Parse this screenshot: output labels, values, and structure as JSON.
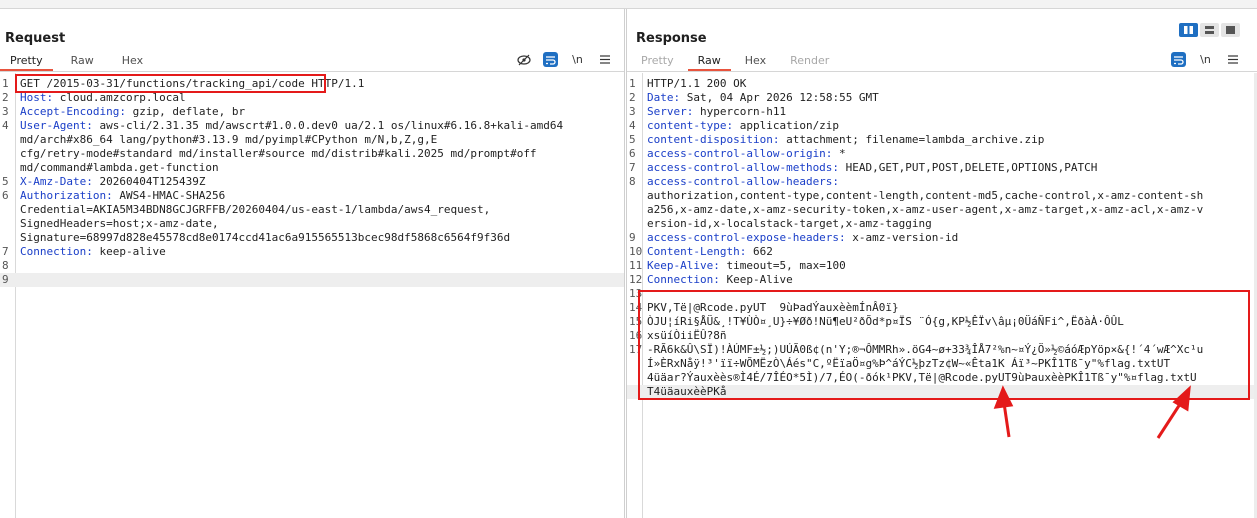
{
  "request": {
    "title": "Request",
    "tabs": [
      "Pretty",
      "Raw",
      "Hex"
    ],
    "active_tab": "Pretty",
    "tools": {
      "newline_label": "\\n"
    },
    "lines": [
      {
        "n": "1",
        "parts": [
          {
            "t": "GET /2015-03-31/functions/tracking_api/code",
            "c": "plain"
          },
          {
            "t": " HTTP/1.1",
            "c": "plain"
          }
        ]
      },
      {
        "n": "2",
        "parts": [
          {
            "t": "Host:",
            "c": "key"
          },
          {
            "t": " cloud.amzcorp.local",
            "c": "plain"
          }
        ]
      },
      {
        "n": "3",
        "parts": [
          {
            "t": "Accept-Encoding:",
            "c": "key"
          },
          {
            "t": " gzip, deflate, br",
            "c": "plain"
          }
        ]
      },
      {
        "n": "4",
        "parts": [
          {
            "t": "User-Agent:",
            "c": "key"
          },
          {
            "t": " aws-cli/2.31.35 md/awscrt#1.0.0.dev0 ua/2.1 os/linux#6.16.8+kali-amd64",
            "c": "plain"
          }
        ]
      },
      {
        "n": "",
        "parts": [
          {
            "t": "md/arch#x86_64 lang/python#3.13.9 md/pyimpl#CPython m/N,b,Z,g,E",
            "c": "plain"
          }
        ]
      },
      {
        "n": "",
        "parts": [
          {
            "t": "cfg/retry-mode#standard md/installer#source md/distrib#kali.2025 md/prompt#off",
            "c": "plain"
          }
        ]
      },
      {
        "n": "",
        "parts": [
          {
            "t": "md/command#lambda.get-function",
            "c": "plain"
          }
        ]
      },
      {
        "n": "5",
        "parts": [
          {
            "t": "X-Amz-Date:",
            "c": "key"
          },
          {
            "t": " 20260404T125439Z",
            "c": "plain"
          }
        ]
      },
      {
        "n": "6",
        "parts": [
          {
            "t": "Authorization:",
            "c": "key"
          },
          {
            "t": " AWS4-HMAC-SHA256",
            "c": "plain"
          }
        ]
      },
      {
        "n": "",
        "parts": [
          {
            "t": "Credential=AKIA5M34BDN8GCJGRFFB/20260404/us-east-1/lambda/aws4_request,",
            "c": "plain"
          }
        ]
      },
      {
        "n": "",
        "parts": [
          {
            "t": "SignedHeaders=host;x-amz-date,",
            "c": "plain"
          }
        ]
      },
      {
        "n": "",
        "parts": [
          {
            "t": "Signature=68997d828e45578cd8e0174ccd41ac6a915565513bcec98df5868c6564f9f36d",
            "c": "plain"
          }
        ]
      },
      {
        "n": "7",
        "parts": [
          {
            "t": "Connection:",
            "c": "key"
          },
          {
            "t": " keep-alive",
            "c": "plain"
          }
        ]
      },
      {
        "n": "8",
        "parts": [
          {
            "t": "",
            "c": "plain"
          }
        ]
      },
      {
        "n": "9",
        "parts": [
          {
            "t": "",
            "c": "plain"
          }
        ]
      }
    ]
  },
  "response": {
    "title": "Response",
    "tabs": [
      "Pretty",
      "Raw",
      "Hex",
      "Render"
    ],
    "active_tab": "Raw",
    "tools": {
      "newline_label": "\\n"
    },
    "lines": [
      {
        "n": "1",
        "parts": [
          {
            "t": "HTTP/1.1 200 OK",
            "c": "plain"
          }
        ]
      },
      {
        "n": "2",
        "parts": [
          {
            "t": "Date:",
            "c": "key"
          },
          {
            "t": " Sat, 04 Apr 2026 12:58:55 GMT",
            "c": "plain"
          }
        ]
      },
      {
        "n": "3",
        "parts": [
          {
            "t": "Server:",
            "c": "key"
          },
          {
            "t": " hypercorn-h11",
            "c": "plain"
          }
        ]
      },
      {
        "n": "4",
        "parts": [
          {
            "t": "content-type:",
            "c": "key"
          },
          {
            "t": " application/zip",
            "c": "plain"
          }
        ]
      },
      {
        "n": "5",
        "parts": [
          {
            "t": "content-disposition:",
            "c": "key"
          },
          {
            "t": " attachment; filename=lambda_archive.zip",
            "c": "plain"
          }
        ]
      },
      {
        "n": "6",
        "parts": [
          {
            "t": "access-control-allow-origin:",
            "c": "key"
          },
          {
            "t": " *",
            "c": "plain"
          }
        ]
      },
      {
        "n": "7",
        "parts": [
          {
            "t": "access-control-allow-methods:",
            "c": "key"
          },
          {
            "t": " HEAD,GET,PUT,POST,DELETE,OPTIONS,PATCH",
            "c": "plain"
          }
        ]
      },
      {
        "n": "8",
        "parts": [
          {
            "t": "access-control-allow-headers:",
            "c": "key"
          }
        ]
      },
      {
        "n": "",
        "parts": [
          {
            "t": "authorization,content-type,content-length,content-md5,cache-control,x-amz-content-sh",
            "c": "plain"
          }
        ]
      },
      {
        "n": "",
        "parts": [
          {
            "t": "a256,x-amz-date,x-amz-security-token,x-amz-user-agent,x-amz-target,x-amz-acl,x-amz-v",
            "c": "plain"
          }
        ]
      },
      {
        "n": "",
        "parts": [
          {
            "t": "ersion-id,x-localstack-target,x-amz-tagging",
            "c": "plain"
          }
        ]
      },
      {
        "n": "9",
        "parts": [
          {
            "t": "access-control-expose-headers:",
            "c": "key"
          },
          {
            "t": " x-amz-version-id",
            "c": "plain"
          }
        ]
      },
      {
        "n": "10",
        "parts": [
          {
            "t": "Content-Length:",
            "c": "key"
          },
          {
            "t": " 662",
            "c": "plain"
          }
        ]
      },
      {
        "n": "11",
        "parts": [
          {
            "t": "Keep-Alive:",
            "c": "key"
          },
          {
            "t": " timeout=5, max=100",
            "c": "plain"
          }
        ]
      },
      {
        "n": "12",
        "parts": [
          {
            "t": "Connection:",
            "c": "key"
          },
          {
            "t": " Keep-Alive",
            "c": "plain"
          }
        ]
      },
      {
        "n": "13",
        "parts": [
          {
            "t": "",
            "c": "plain"
          }
        ]
      },
      {
        "n": "14",
        "parts": [
          {
            "t": "PKV,Të|@Rcode.pyUT  9ùÞadÝauxèèmÍnÂ0ï}",
            "c": "plain"
          }
        ]
      },
      {
        "n": "15",
        "parts": [
          {
            "t": "ÒJU¦íRi§ÅÜ&¸!T¥ÙÒ¤¸U}÷¥Øð!Nü¶eU²ðÕd*p¤ÏS ¨Ó{g,KP½ÊÏv\\âµ¡0ÜáÑFi^,ËðàÀ·ÔÛL",
            "c": "plain"
          }
        ]
      },
      {
        "n": "16",
        "parts": [
          {
            "t": "xsüíÒiiËÛ?8ñ",
            "c": "plain"
          }
        ]
      },
      {
        "n": "17",
        "parts": [
          {
            "t": "-RÃ6k&Û\\SÏ)!ÀÚMF±½;)UÚÃ0ß¢(n'Y;®¬ÔMMRh».öG4~ø+33¾ÎÅ7²%n~¤Ý¿Ö»½©áóÆpYöp×&{!´4´wÆ^Xc¹u",
            "c": "plain"
          }
        ]
      },
      {
        "n": "",
        "parts": [
          {
            "t": "Í»ÈRxNåÿ!³'ïï÷WÕMËzÒ\\Áés\"C,ºËïaÖ¤g%Þ^áÝC½þzTz¢W~«Êta1K Áï³~PKÎ1Tß¯y\"%flag.txtUT",
            "c": "plain"
          }
        ]
      },
      {
        "n": "",
        "parts": [
          {
            "t": "4üäar?Ýauxèès®Ì4É/7ÎÉO*5Ì)/7,ÉO(-ðók¹PKV,Të|@Rcode.pyUT9ùÞauxèèPKÎ1Tß¯y\"%¤flag.txtU",
            "c": "plain"
          }
        ]
      },
      {
        "n": "",
        "parts": [
          {
            "t": "T4üäauxèèPKå",
            "c": "plain"
          }
        ]
      }
    ]
  },
  "colors": {
    "accent": "#1f6fc2",
    "highlight": "#e41a1a",
    "tab_underline": "#e8543e",
    "header_key": "#1a3ec8"
  },
  "icons": {
    "view_toggle": [
      "layout-split-icon",
      "layout-rows-icon",
      "layout-single-icon"
    ],
    "request_tools": [
      "hide-non-printable-icon",
      "wrap-lines-icon",
      "newline-icon",
      "menu-icon"
    ],
    "response_tools": [
      "wrap-lines-icon",
      "newline-icon",
      "menu-icon"
    ]
  }
}
